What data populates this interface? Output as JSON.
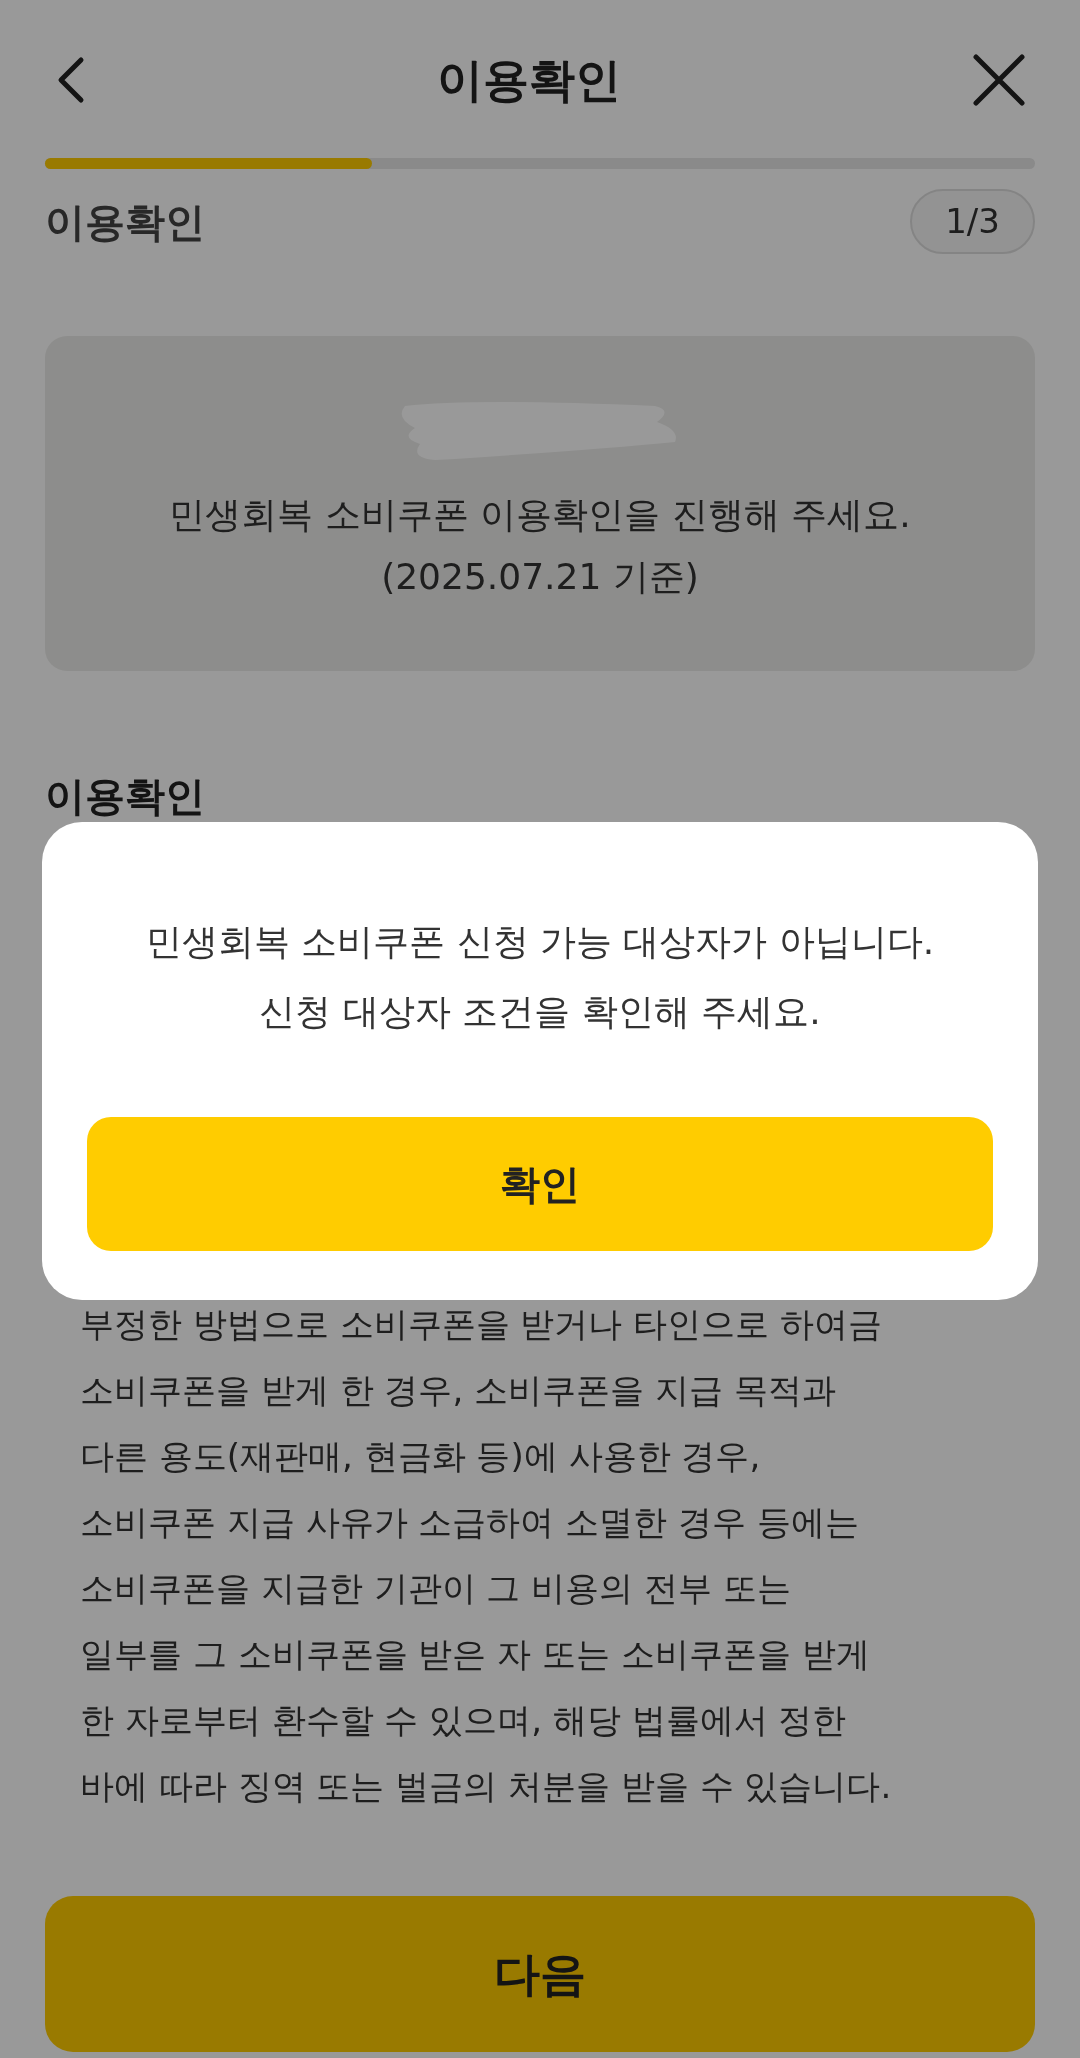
{
  "header": {
    "title": "이용확인"
  },
  "progress": {
    "level": 0.33
  },
  "section": {
    "title": "이용확인",
    "step": "1/3"
  },
  "info_card": {
    "lines": [
      "민생회복 소비쿠폰 이용확인을 진행해 주세요.",
      "(2025.07.21 기준)"
    ]
  },
  "section2": {
    "title": "이용확인"
  },
  "body": {
    "lines": [
      "부정한 방법으로 소비쿠폰을 받거나 타인으로 하여금",
      "소비쿠폰을 받게 한 경우, 소비쿠폰을 지급 목적과",
      "다른 용도(재판매, 현금화 등)에 사용한 경우,",
      "소비쿠폰 지급 사유가 소급하여 소멸한 경우 등에는",
      "소비쿠폰을 지급한 기관이 그 비용의 전부 또는",
      "일부를 그 소비쿠폰을 받은 자 또는 소비쿠폰을 받게",
      "한 자로부터 환수할 수 있으며, 해당 법률에서 정한",
      "바에 따라 징역 또는 벌금의 처분을 받을 수 있습니다."
    ]
  },
  "next_button": "다음",
  "dialog": {
    "lines": [
      "민생회복 소비쿠폰 신청 가능 대상자가 아닙니다.",
      "신청 대상자 조건을 확인해 주세요."
    ],
    "button": "확인"
  }
}
